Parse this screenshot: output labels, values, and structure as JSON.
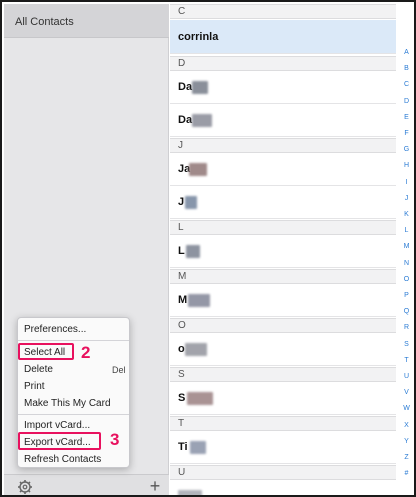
{
  "sidebar": {
    "header": "All Contacts",
    "footer": {
      "settings_icon": "gear-icon",
      "add_icon": "plus-icon",
      "add_label": "+"
    }
  },
  "list": {
    "sections": [
      {
        "letter": "C",
        "contacts": [
          {
            "name": "corrinla",
            "selected": true
          }
        ]
      },
      {
        "letter": "D",
        "contacts": [
          {
            "name": "Da"
          },
          {
            "name": "Da"
          }
        ]
      },
      {
        "letter": "J",
        "contacts": [
          {
            "name": "Ja"
          },
          {
            "name": "J"
          }
        ]
      },
      {
        "letter": "L",
        "contacts": [
          {
            "name": "L"
          }
        ]
      },
      {
        "letter": "M",
        "contacts": [
          {
            "name": "M"
          }
        ]
      },
      {
        "letter": "O",
        "contacts": [
          {
            "name": "o"
          }
        ]
      },
      {
        "letter": "S",
        "contacts": [
          {
            "name": "S"
          }
        ]
      },
      {
        "letter": "T",
        "contacts": [
          {
            "name": "Ti"
          }
        ]
      },
      {
        "letter": "U",
        "contacts": []
      }
    ]
  },
  "index_letters": [
    "A",
    "B",
    "C",
    "D",
    "E",
    "F",
    "G",
    "H",
    "I",
    "J",
    "K",
    "L",
    "M",
    "N",
    "O",
    "P",
    "Q",
    "R",
    "S",
    "T",
    "U",
    "V",
    "W",
    "X",
    "Y",
    "Z",
    "#"
  ],
  "menu": {
    "preferences": "Preferences...",
    "select_all": "Select All",
    "delete": "Delete",
    "delete_key": "Del",
    "print": "Print",
    "make_my_card": "Make This My Card",
    "import_vcard": "Import vCard...",
    "export_vcard": "Export vCard...",
    "refresh": "Refresh Contacts"
  },
  "annotations": {
    "step2": "2",
    "step3": "3",
    "color": "#e8115e"
  },
  "colors": {
    "accent": "#2a7bd4",
    "selected_row": "#dbe9f8"
  }
}
